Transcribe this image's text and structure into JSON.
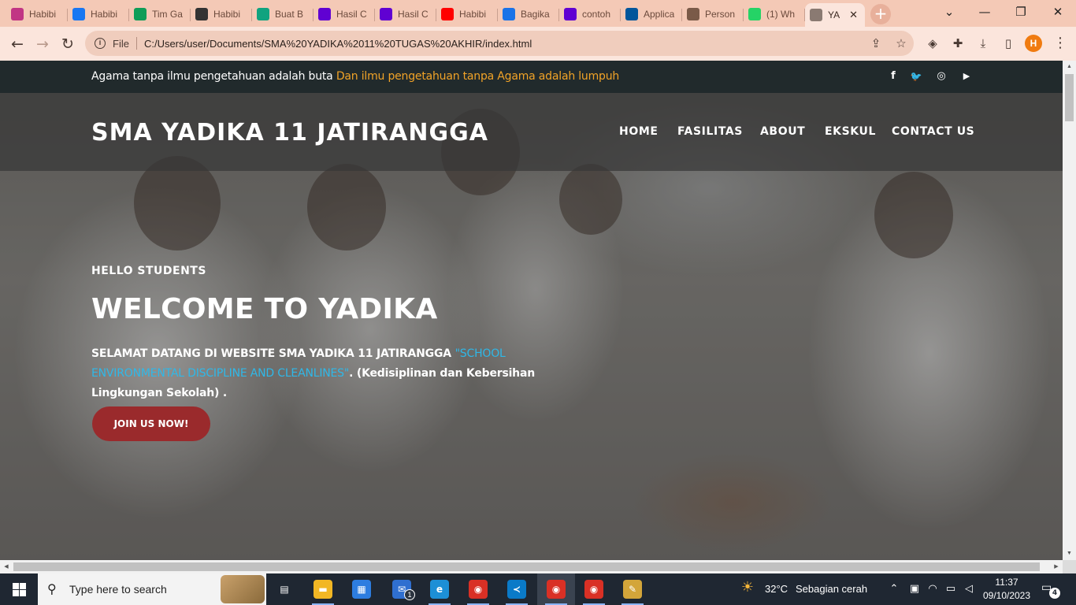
{
  "browser": {
    "tabs": [
      {
        "label": "Habibi",
        "icon": "instagram-icon",
        "color": "#c13584"
      },
      {
        "label": "Habibi",
        "icon": "facebook-icon",
        "color": "#1877f2"
      },
      {
        "label": "Tim Ga",
        "icon": "sheets-icon",
        "color": "#0f9d58"
      },
      {
        "label": "Habibi",
        "icon": "github-icon",
        "color": "#333333"
      },
      {
        "label": "Buat B",
        "icon": "chatgpt-icon",
        "color": "#10a37f"
      },
      {
        "label": "Hasil C",
        "icon": "yahoo-icon",
        "color": "#6001d2"
      },
      {
        "label": "Hasil C",
        "icon": "yahoo-icon",
        "color": "#6001d2"
      },
      {
        "label": "Habibi",
        "icon": "youtube-icon",
        "color": "#ff0000"
      },
      {
        "label": "Bagika",
        "icon": "loading-icon",
        "color": "#1a73e8"
      },
      {
        "label": "contoh",
        "icon": "yahoo-icon",
        "color": "#6001d2"
      },
      {
        "label": "Applica",
        "icon": "flutter-icon",
        "color": "#02569b"
      },
      {
        "label": "Person",
        "icon": "avatar-icon",
        "color": "#7a5a48"
      },
      {
        "label": "(1) Wh",
        "icon": "whatsapp-icon",
        "color": "#25d366"
      },
      {
        "label": "YA",
        "icon": "globe-icon",
        "color": "#8a7a72",
        "active": true
      }
    ],
    "tab_close": "✕",
    "new_tab": "+",
    "window": {
      "collapse": "⌄",
      "minimize": "—",
      "restore": "❐",
      "close": "✕"
    },
    "nav": {
      "back": "←",
      "forward": "→",
      "reload": "↻"
    },
    "address": {
      "scheme": "File",
      "url": "C:/Users/user/Documents/SMA%20YADIKA%2011%20TUGAS%20AKHIR/index.html"
    },
    "toolbar_icons": {
      "share": "⇪",
      "bookmark": "☆",
      "ext1": "◈",
      "extensions": "✚",
      "download": "⤓",
      "sidepanel": "▯",
      "menu": "⋮"
    },
    "profile_initial": "H"
  },
  "page": {
    "topbar": {
      "quote_main": "Agama tanpa ilmu pengetahuan adalah buta ",
      "quote_highlight": "Dan ilmu pengetahuan tanpa Agama adalah lumpuh",
      "social": [
        {
          "name": "facebook-icon",
          "glyph": "f"
        },
        {
          "name": "twitter-icon",
          "glyph": "🐦"
        },
        {
          "name": "instagram-icon",
          "glyph": "◎"
        },
        {
          "name": "youtube-icon",
          "glyph": "▶"
        }
      ]
    },
    "header": {
      "brand": "SMA YADIKA 11 JATIRANGGA",
      "nav": [
        "HOME",
        "FASILITAS",
        "ABOUT",
        "EKSKUL",
        "CONTACT US"
      ]
    },
    "hero": {
      "eyebrow": "HELLO STUDENTS",
      "title": "WELCOME TO YADIKA",
      "intro_strong": "SELAMAT DATANG DI WEBSITE SMA YADIKA 11 JATIRANGGA ",
      "intro_highlight": "\"SCHOOL ENVIRONMENTAL DISCIPLINE AND CLEANLINES\"",
      "intro_rest": ". (Kedisiplinan dan Kebersihan Lingkungan Sekolah) .",
      "cta": "JOIN US NOW!"
    }
  },
  "taskbar": {
    "search_placeholder": "Type here to search",
    "apps": [
      {
        "name": "task-view-icon",
        "glyph": "▤",
        "color": "#1f2732"
      },
      {
        "name": "file-explorer-icon",
        "glyph": "▬",
        "color": "#f2b724"
      },
      {
        "name": "microsoft-store-icon",
        "glyph": "▦",
        "color": "#2d7de0"
      },
      {
        "name": "mail-icon",
        "glyph": "✉",
        "color": "#2f6fd0",
        "badge": "1"
      },
      {
        "name": "edge-icon",
        "glyph": "e",
        "color": "#1d8fd6"
      },
      {
        "name": "chrome-icon",
        "glyph": "◉",
        "color": "#d93025"
      },
      {
        "name": "vscode-icon",
        "glyph": "≺",
        "color": "#0a7ac8"
      },
      {
        "name": "chrome-profile-icon",
        "glyph": "◉",
        "color": "#d93025",
        "running": true
      },
      {
        "name": "chrome-icon",
        "glyph": "◉",
        "color": "#d93025"
      },
      {
        "name": "paint-icon",
        "glyph": "✎",
        "color": "#d3a53a"
      }
    ],
    "weather_temp": "32°C",
    "weather_desc": "Sebagian cerah",
    "time": "11:37",
    "date": "09/10/2023",
    "notifications": "4"
  }
}
